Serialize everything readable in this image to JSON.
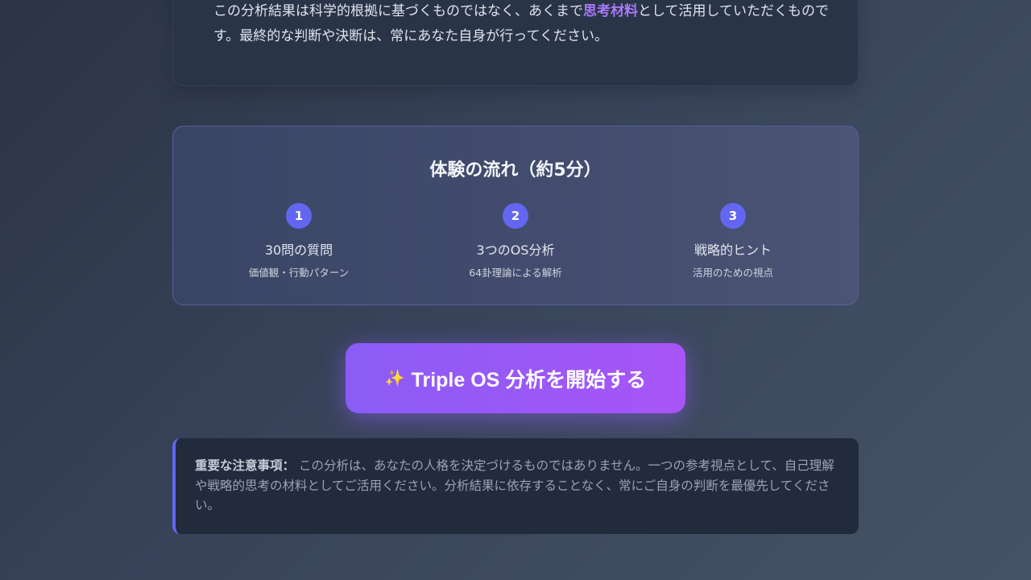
{
  "disclaimer": {
    "text_before": "この分析結果は科学的根拠に基づくものではなく、あくまで",
    "highlight": "思考材料",
    "text_after": "として活用していただくものです。最終的な判断や決断は、常にあなた自身が行ってください。"
  },
  "flow": {
    "title": "体験の流れ（約5分）",
    "steps": [
      {
        "number": "1",
        "title": "30問の質問",
        "subtitle": "価値観・行動パターン"
      },
      {
        "number": "2",
        "title": "3つのOS分析",
        "subtitle": "64卦理論による解析"
      },
      {
        "number": "3",
        "title": "戦略的ヒント",
        "subtitle": "活用のための視点"
      }
    ]
  },
  "start_button": {
    "icon": "sparkles-icon",
    "glyph": "✨",
    "label": "Triple OS 分析を開始する"
  },
  "notice": {
    "label": "重要な注意事項：",
    "text": " この分析は、あなたの人格を決定づけるものではありません。一つの参考視点として、自己理解や戦略的思考の材料としてご活用ください。分析結果に依存することなく、常にご自身の判断を最優先してください。"
  },
  "colors": {
    "accent": "#6366f1",
    "highlight": "#a779f7",
    "button_start": "#8b5cf6",
    "button_end": "#a855f7"
  }
}
